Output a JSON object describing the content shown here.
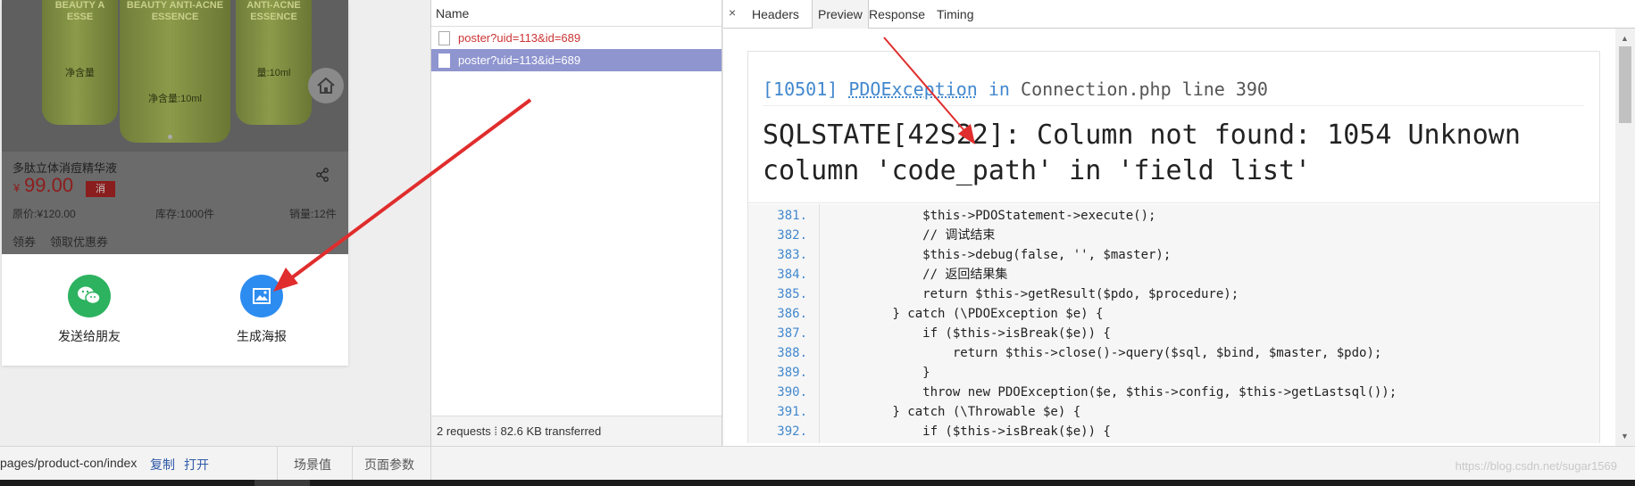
{
  "product": {
    "bottle_texts": [
      "BEAUTY A\nESSE",
      "BEAUTY ANTI-ACNE\nESSENCE",
      "ANTI-ACNE\nESSENCE"
    ],
    "bottle_vols": [
      "净含量",
      "净含量:10ml",
      "量:10ml"
    ],
    "title": "多肽立体消痘精华液",
    "currency": "¥",
    "price": "99.00",
    "badge": "消",
    "original_price": "原价:¥120.00",
    "stock": "库存:1000件",
    "sales": "销量:12件",
    "coupon_label": "领券",
    "coupon_action": "领取优惠券"
  },
  "actions": {
    "send_friend": "发送给朋友",
    "make_poster": "生成海报"
  },
  "network": {
    "header": "Name",
    "requests": [
      {
        "name": "poster?uid=113&id=689",
        "selected": false
      },
      {
        "name": "poster?uid=113&id=689",
        "selected": true
      }
    ],
    "footer": "2 requests  ⁞  82.6 KB transferred"
  },
  "preview": {
    "close": "×",
    "tabs": [
      "Headers",
      "Preview",
      "Response",
      "Timing"
    ],
    "active_tab": "Preview",
    "error_code": "[10501]",
    "error_class": "PDOException",
    "error_in": "in",
    "error_file": "Connection.php line 390",
    "error_message": "SQLSTATE[42S22]: Column not found: 1054 Unknown column 'code_path' in 'field list'",
    "code_lines": [
      {
        "num": "381.",
        "src": "            $this->PDOStatement->execute();"
      },
      {
        "num": "382.",
        "src": "            // 调试结束"
      },
      {
        "num": "383.",
        "src": "            $this->debug(false, '', $master);"
      },
      {
        "num": "384.",
        "src": "            // 返回结果集"
      },
      {
        "num": "385.",
        "src": "            return $this->getResult($pdo, $procedure);"
      },
      {
        "num": "386.",
        "src": "        } catch (\\PDOException $e) {"
      },
      {
        "num": "387.",
        "src": "            if ($this->isBreak($e)) {"
      },
      {
        "num": "388.",
        "src": "                return $this->close()->query($sql, $bind, $master, $pdo);"
      },
      {
        "num": "389.",
        "src": "            }"
      },
      {
        "num": "390.",
        "src": "            throw new PDOException($e, $this->config, $this->getLastsql());"
      },
      {
        "num": "391.",
        "src": "        } catch (\\Throwable $e) {"
      },
      {
        "num": "392.",
        "src": "            if ($this->isBreak($e)) {"
      }
    ]
  },
  "bottombar": {
    "path": "pages/product-con/index",
    "copy": "复制",
    "open": "打开",
    "scene": "场景值",
    "params": "页面参数"
  },
  "watermark": "https://blog.csdn.net/sugar1569",
  "colors": {
    "wechat_green": "#2db25f",
    "poster_blue": "#2d8cf0",
    "arrow_red": "#e02d2d",
    "selected_row": "#8f95cf",
    "error_blue": "#4288ce"
  }
}
